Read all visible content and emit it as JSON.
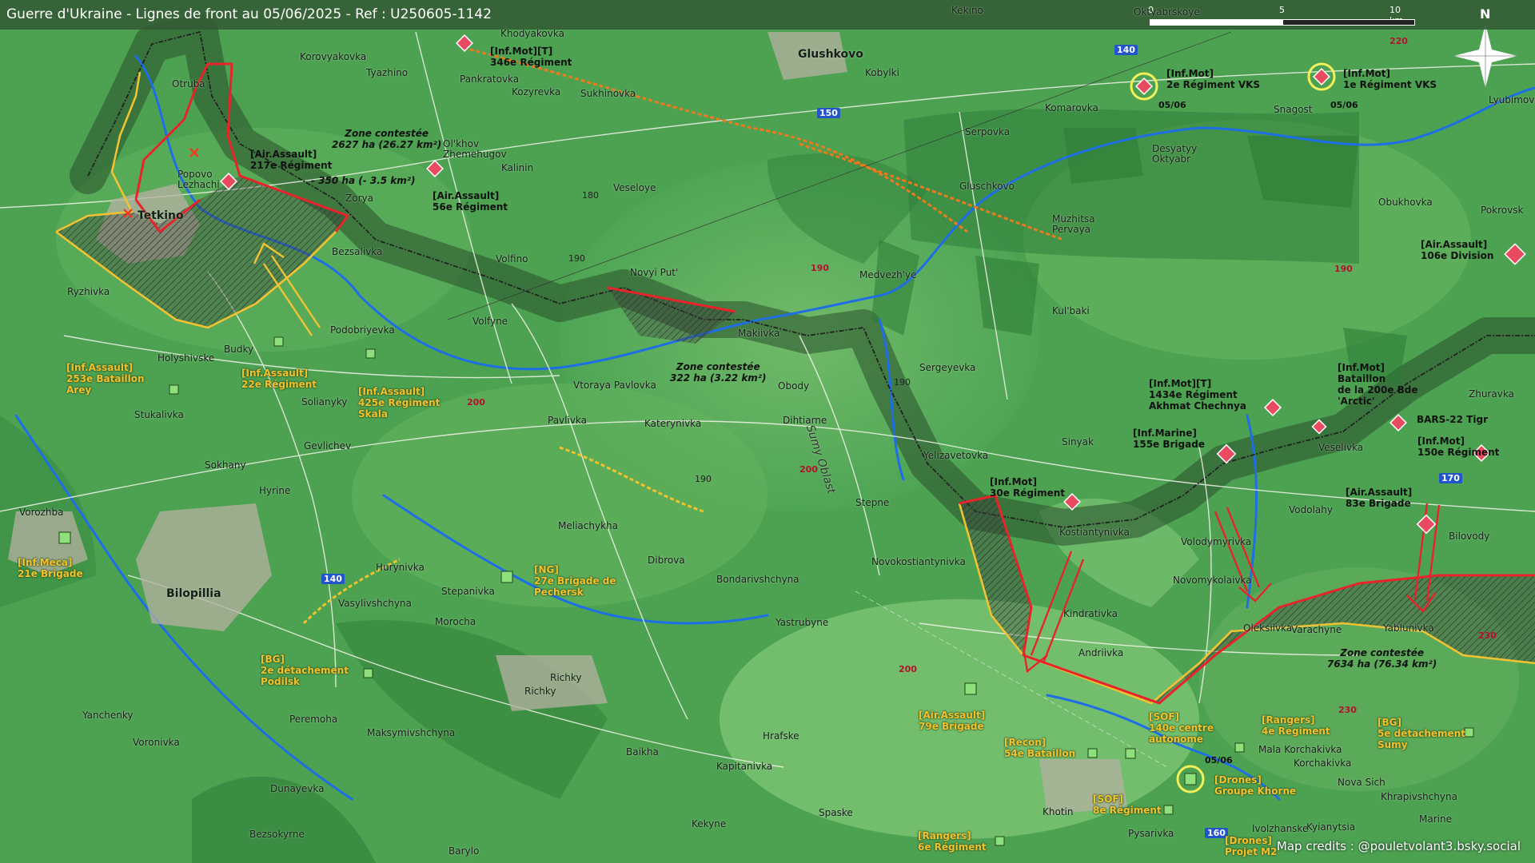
{
  "title": "Guerre d'Ukraine - Lignes de front au 05/06/2025 - Ref : U250605-1142",
  "credits": "Map credits : @pouletvolant3.bsky.social",
  "scale": {
    "zero": "0",
    "mid": "5",
    "end": "10 km"
  },
  "north": "N",
  "colors": {
    "terrain": "#3f9a47",
    "front_line": "#e8232a",
    "ua_line": "#f1c232",
    "border": "#222222",
    "river": "#1e6ee6",
    "fortification": "#ee7a1e"
  },
  "places": {
    "glushkovo": "Glushkovo",
    "tetkino": "Tetkino",
    "bilopillia": "Bilopillia",
    "vorozhba": "Vorozhba",
    "kekino": "Kekino",
    "krasnyi_oktyabr": "Oktyabrskoye",
    "khodyakovka": "Khodyakovka",
    "korovyakovka": "Korovyakovka",
    "tyazhino": "Tyazhino",
    "pankratovka": "Pankratovka",
    "kozyrevka": "Kozyrevka",
    "sukhinovka": "Sukhinovka",
    "otruba": "Otruba",
    "popovo": "Popovo\nLezhachi",
    "olkhov": "Ol'khov\nZhemehugov",
    "kalinin": "Kalinin",
    "zorya": "Zorya",
    "bezsalivka": "Bezsalivka",
    "volfino": "Volfino",
    "veseloye": "Veseloye",
    "novyi_put": "Novyi Put'",
    "volfyne": "Volfyne",
    "ryzhivka": "Ryzhivka",
    "holyshivske": "Holyshivske",
    "budky": "Budky",
    "podobriyevka": "Podobriyevka",
    "stukalivka": "Stukalivka",
    "solianyky": "Solianyky",
    "gevlichev": "Gevlichev",
    "sokhany": "Sokhany",
    "hyrine": "Hyrine",
    "vtoraya": "Vtoraya Pavlovka",
    "pavlivka": "Pavlivka",
    "makiivka": "Makiivka",
    "katerynivka": "Katerynivka",
    "obody": "Obody",
    "dihtiarne": "Dihtiarne",
    "meliachykha": "Meliachykha",
    "dibrova": "Dibrova",
    "bondarivshchyna": "Bondarivshchyna",
    "yastrubyne": "Yastrubyne",
    "hurynivka": "Hurynivka",
    "stepanivka": "Stepanivka",
    "vasylivshchyna": "Vasylivshchyna",
    "morocha": "Morocha",
    "richky1": "Richky",
    "richky2": "Richky",
    "peremoha": "Peremoha",
    "maksymivshchyna": "Maksymivshchyna",
    "baikha": "Baikha",
    "hrafske": "Hrafske",
    "kapitanivka": "Kapitanivka",
    "spaske": "Spaske",
    "kekyne": "Kekyne",
    "barylo": "Barylo",
    "yanchenky": "Yanchenky",
    "voronivka": "Voronivka",
    "dunayevka": "Dunayevka",
    "bezsokyrne": "Bezsokyrne",
    "kobylki": "Kobylki",
    "serpovka": "Serpovka",
    "gluschkovo2": "Gluschkovo",
    "komarovka": "Komarovka",
    "desyatyy": "Desyatyy\nOktyabr",
    "snagost": "Snagost",
    "lyubimovka": "Lyubimovka",
    "obukhovka": "Obukhovka",
    "pokrovsk": "Pokrovsk",
    "muzhitsa": "Muzhitsa\nPervaya",
    "medvezhye": "Medvezh'ye",
    "kulbaki": "Kul'baki",
    "sergeyevka": "Sergeyevka",
    "yelizavetovka": "Yelizavetovka",
    "sinyak": "Sinyak",
    "stepne": "Stepne",
    "novokostiantynivka": "Novokostiantynivka",
    "kostiantynivka": "Kostiantynivka",
    "volodymyrivka": "Volodymyrivka",
    "novomykolaivka": "Novomykolaivka",
    "kindrativka": "Kindrativka",
    "andriivka": "Andriivka",
    "oleksiivka": "Oleksiivka",
    "varachyne": "Varachyne",
    "yablunivka": "Yablunivka",
    "bilovody": "Bilovody",
    "vodolahy": "Vodolahy",
    "veselivka": "Veselivka",
    "zhuravka": "Zhuravka",
    "mala_korchakivka": "Mala Korchakivka",
    "korchakivka": "Korchakivka",
    "nova_sich": "Nova Sich",
    "khrapivshchyna": "Khrapivshchyna",
    "marine": "Marine",
    "kyianytsia": "Kyianytsia",
    "ivolzhanske": "Ivolzhanske",
    "khotin": "Khotin",
    "pysarivka": "Pysarivka",
    "sumy_oblast": "Sumy Oblast"
  },
  "roads": {
    "r140a": "140",
    "r150": "150",
    "r140b": "140",
    "r170": "170",
    "r160": "160"
  },
  "elevations": {
    "e220": "220",
    "e180": "180",
    "e190a": "190",
    "e190b": "190",
    "e190c": "190",
    "e200a": "200",
    "e190d": "190",
    "e200b": "200",
    "e190e": "190",
    "e200c": "200",
    "e230a": "230",
    "e230b": "230"
  },
  "dates": {
    "d1": "05/06",
    "d2": "05/06",
    "d3": "05/06"
  },
  "zones": {
    "z1": "Zone contestée\n2627 ha (26.27 km²)",
    "z1b": "- 350 ha (- 3.5 km²)",
    "z2": "Zone contestée\n322 ha (3.22 km²)",
    "z3": "Zone contestée\n7634 ha (76.34 km²)"
  },
  "russian_units": {
    "u346": "[Inf.Mot][T]\n346e Régiment",
    "uvks2": "[Inf.Mot]\n2e Régiment VKS",
    "uvks1": "[Inf.Mot]\n1e Régiment VKS",
    "u217": "[Air.Assault]\n217e Régiment",
    "u56": "[Air.Assault]\n56e Régiment",
    "u106": "[Air.Assault]\n106e Division",
    "u1434": "[Inf.Mot][T]\n1434e Régiment\nAkhmat Chechnya",
    "u200": "[Inf.Mot]\nBataillon\nde la 200e Bde\n'Arctic'",
    "ubars": "BARS-22 Tigr",
    "u155": "[Inf.Marine]\n155e Brigade",
    "u150": "[Inf.Mot]\n150e Régiment",
    "u30": "[Inf.Mot]\n30e Régiment",
    "u83": "[Air.Assault]\n83e Brigade"
  },
  "ukrainian_units": {
    "u253": "[Inf.Assault]\n253e Bataillon\nArey",
    "u22": "[Inf.Assault]\n22e Régiment",
    "u425": "[Inf.Assault]\n425e Régiment\nSkala",
    "u21": "[Inf.Meca]\n21e Brigade",
    "u27": "[NG]\n27e Brigade de\nPechersk",
    "u2bg": "[BG]\n2e détachement\nPodilsk",
    "u79": "[Air.Assault]\n79e Brigade",
    "u54": "[Recon]\n54e Bataillon",
    "u140": "[SOF]\n140e centre\nautonome",
    "u4r": "[Rangers]\n4e Régiment",
    "u5bg": "[BG]\n5e détachement\nSumy",
    "ukhorne": "[Drones]\nGroupe Khorne",
    "u8sof": "[SOF]\n8e Régiment",
    "u6r": "[Rangers]\n6e Régiment",
    "um2": "[Drones]\nProjet M2"
  }
}
